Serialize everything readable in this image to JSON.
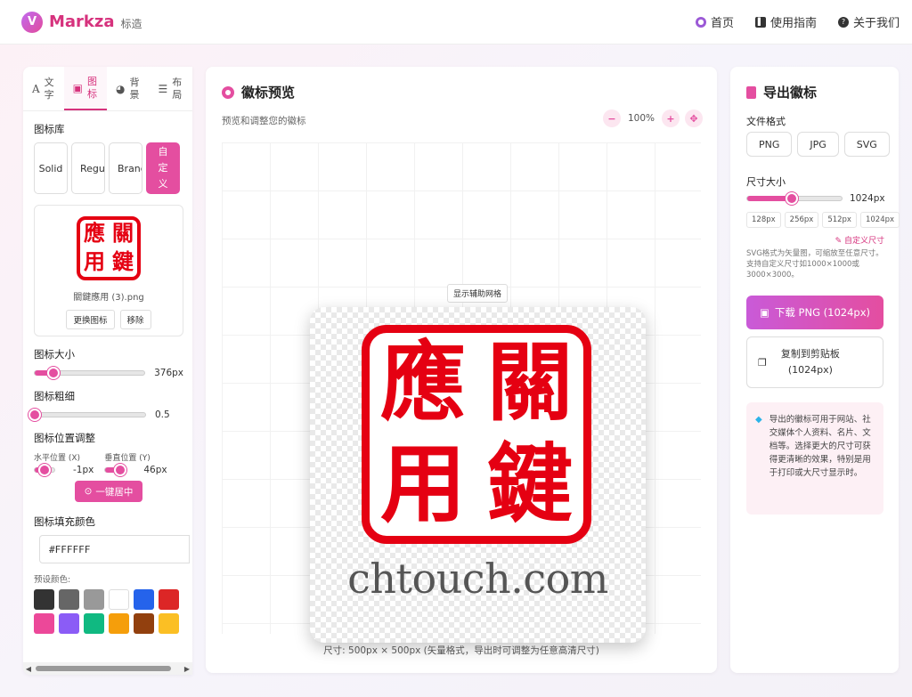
{
  "header": {
    "brand_name": "Markza",
    "brand_sub": "标造",
    "brand_logo": "V",
    "nav": [
      {
        "label": "首页",
        "icon": "home-icon",
        "color": "#9b59d6"
      },
      {
        "label": "使用指南",
        "icon": "book-icon",
        "color": "#333333"
      },
      {
        "label": "关于我们",
        "icon": "question-icon",
        "color": "#333333"
      }
    ]
  },
  "left": {
    "tabs": [
      {
        "label": "文字",
        "icon": "A",
        "active": false
      },
      {
        "label": "图标",
        "icon": "🖼",
        "active": true
      },
      {
        "label": "背景",
        "icon": "🎨",
        "active": false
      },
      {
        "label": "布局",
        "icon": "≡",
        "active": false
      }
    ],
    "library_title": "图标库",
    "library_buttons": [
      "Solid",
      "Regular",
      "Brands",
      "自定义"
    ],
    "custom_icon": {
      "chars": [
        "應",
        "關",
        "用",
        "鍵"
      ],
      "filename": "關鍵應用 (3).png",
      "replace_label": "更换图标",
      "remove_label": "移除"
    },
    "size": {
      "label": "图标大小",
      "value": "376px",
      "fraction": 0.17
    },
    "weight": {
      "label": "图标粗细",
      "value": "0.5",
      "fraction": 0.0
    },
    "position": {
      "title": "图标位置调整",
      "h_label": "水平位置 (X)",
      "h_value": "-1px",
      "v_label": "垂直位置 (Y)",
      "v_value": "46px",
      "center_label": "一键居中"
    },
    "fill": {
      "title": "图标填充颜色",
      "value": "#FFFFFF"
    },
    "preset_label": "预设颜色:",
    "preset_colors": [
      "#333333",
      "#666666",
      "#999999",
      "#ffffff",
      "#2563eb",
      "#dc2626",
      "#ec4899",
      "#8b5cf6",
      "#10b981",
      "#f59e0b",
      "#92400e",
      "#fbbf24"
    ]
  },
  "center": {
    "title": "徽标预览",
    "subtitle": "预览和调整您的徽标",
    "zoom": "100%",
    "grid_button": "显示辅助网格",
    "seal_chars": [
      "應",
      "關",
      "用",
      "鍵"
    ],
    "caption": "chtouch.com",
    "size_note": "尺寸: 500px × 500px (矢量格式，导出时可调整为任意高清尺寸)"
  },
  "right": {
    "title": "导出徽标",
    "format_label": "文件格式",
    "formats": [
      {
        "label": "PNG",
        "active": true
      },
      {
        "label": "JPG",
        "active": false
      },
      {
        "label": "SVG",
        "active": false
      }
    ],
    "size_label": "尺寸大小",
    "size_value": "1024px",
    "size_fraction": 0.47,
    "presets": [
      {
        "label": "128px",
        "active": false
      },
      {
        "label": "256px",
        "active": false
      },
      {
        "label": "512px",
        "active": false
      },
      {
        "label": "1024px",
        "active": true
      }
    ],
    "custom_size": "自定义尺寸",
    "svg_note": "SVG格式为矢量图，可缩放至任意尺寸。支持自定义尺寸如1000×1000或3000×3000。",
    "download_label": "下载 PNG (1024px)",
    "copy_label_1": "复制到剪贴板",
    "copy_label_2": "(1024px)",
    "info": "导出的徽标可用于网站、社交媒体个人资料、名片、文档等。选择更大的尺寸可获得更清晰的效果，特别是用于打印或大尺寸显示时。"
  }
}
